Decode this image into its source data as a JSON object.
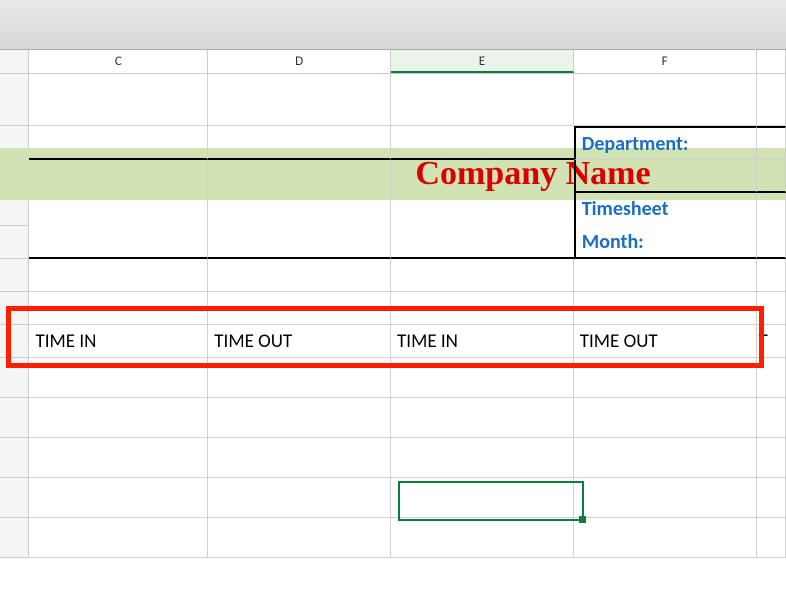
{
  "columns": {
    "C": "C",
    "D": "D",
    "E": "E",
    "F": "F"
  },
  "company_name": "Company Name",
  "labels": {
    "department": "Department:",
    "timesheet": "Timesheet",
    "month": "Month:"
  },
  "table_headers": {
    "c": "TIME IN",
    "d": "TIME OUT",
    "e": "TIME IN",
    "f": "TIME OUT",
    "g_partial": "T"
  },
  "chart_data": {
    "type": "table",
    "title": "Company Name",
    "columns": [
      "TIME IN",
      "TIME OUT",
      "TIME IN",
      "TIME OUT"
    ],
    "rows": [],
    "meta_labels": [
      "Department:",
      "Timesheet Month:"
    ]
  },
  "selected_column": "E"
}
